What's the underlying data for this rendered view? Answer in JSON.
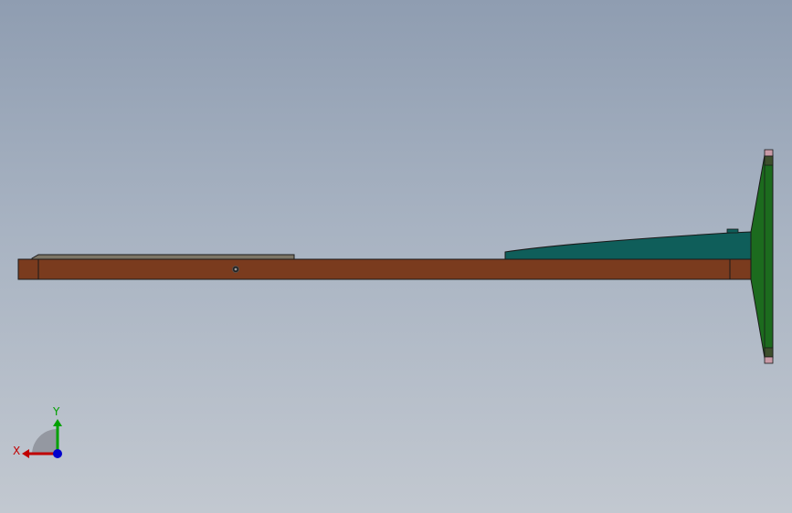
{
  "viewport": {
    "background_top": "#8f9db1",
    "background_bottom": "#c2c8d0"
  },
  "model": {
    "colors": {
      "main_rail": "#7a3b1e",
      "top_plate": "#7d7666",
      "wedge_block": "#0f5e5a",
      "end_plate": "#1c6b1e",
      "end_caps": "#c99aa6",
      "outline": "#1a1a1a"
    }
  },
  "triad": {
    "x_label": "X",
    "y_label": "Y",
    "x_color": "#c00000",
    "y_color": "#00a000",
    "z_color": "#0000cc"
  }
}
